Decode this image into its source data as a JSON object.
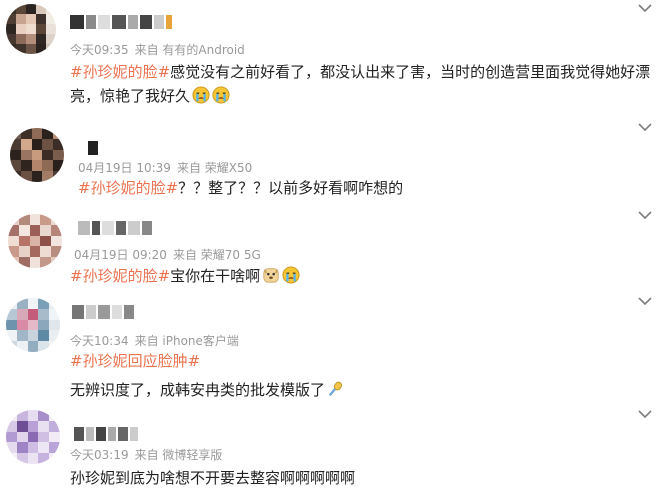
{
  "comments": [
    {
      "time": "今天09:35",
      "source": "来自 有有的Android",
      "hashtag": "#孙珍妮的脸#",
      "text_line1": "感觉没有之前好看了，都没认出来了害，当时的创造营里面我觉得她好漂",
      "text_line2": "亮，惊艳了我好久"
    },
    {
      "time": "04月19日 10:39",
      "source": "来自 荣耀X50",
      "hashtag": "#孙珍妮的脸#",
      "text": "？？整了？？以前多好看啊咋想的"
    },
    {
      "time": "04月19日 09:20",
      "source": "来自 荣耀70 5G",
      "hashtag": "#孙珍妮的脸#",
      "text": "宝你在干啥啊"
    },
    {
      "time": "今天10:34",
      "source": "来自 iPhone客户端",
      "hashtag": "#孙珍妮回应脸肿#",
      "text": "无辨识度了，成韩安冉类的批发模版了"
    },
    {
      "time": "今天03:19",
      "source": "来自 微博轻享版",
      "text": "孙珍妮到底为啥想不开要去整容啊啊啊啊啊"
    }
  ],
  "icons": {
    "more": "chevron-down-icon",
    "crying": "crying-face-icon",
    "dog": "dog-face-icon",
    "microphone": "microphone-icon"
  },
  "colors": {
    "hashtag": "#eb7350",
    "meta": "#9a9a9a",
    "text": "#222222"
  }
}
